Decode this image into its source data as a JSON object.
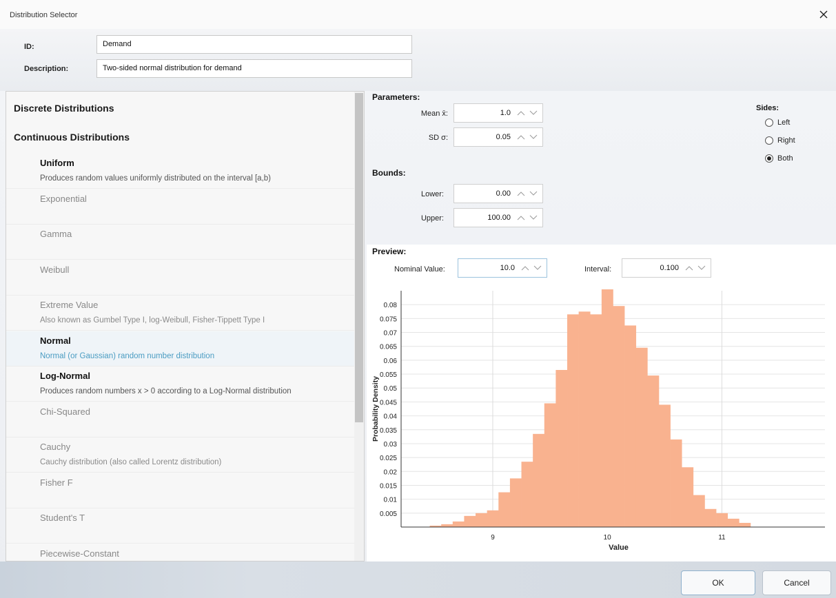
{
  "window": {
    "title": "Distribution Selector"
  },
  "form": {
    "id_label": "ID:",
    "id_value": "Demand",
    "desc_label": "Description:",
    "desc_value": "Two-sided normal distribution for demand"
  },
  "categories": {
    "discrete": "Discrete Distributions",
    "continuous": "Continuous Distributions"
  },
  "distributions": [
    {
      "name": "Uniform",
      "desc": "Produces random values uniformly distributed on the interval [a,b)",
      "style": "bold"
    },
    {
      "name": "Exponential",
      "desc": "",
      "style": "normal"
    },
    {
      "name": "Gamma",
      "desc": "",
      "style": "normal"
    },
    {
      "name": "Weibull",
      "desc": "",
      "style": "normal"
    },
    {
      "name": "Extreme Value",
      "desc": "Also known as Gumbel Type I, log-Weibull, Fisher-Tippett Type I",
      "style": "normal"
    },
    {
      "name": "Normal",
      "desc": "Normal (or Gaussian) random number distribution",
      "style": "selected"
    },
    {
      "name": "Log-Normal",
      "desc": "Produces random numbers x > 0 according to a Log-Normal distribution",
      "style": "bold"
    },
    {
      "name": "Chi-Squared",
      "desc": "",
      "style": "normal"
    },
    {
      "name": "Cauchy",
      "desc": "Cauchy distribution (also called Lorentz distribution)",
      "style": "normal"
    },
    {
      "name": "Fisher F",
      "desc": "",
      "style": "normal"
    },
    {
      "name": "Student's T",
      "desc": "",
      "style": "normal"
    },
    {
      "name": "Piecewise-Constant",
      "desc": "",
      "style": "normal"
    }
  ],
  "parameters": {
    "label": "Parameters:",
    "mean_label": "Mean x̄:",
    "mean_value": "1.0",
    "sd_label": "SD σ:",
    "sd_value": "0.05"
  },
  "bounds": {
    "label": "Bounds:",
    "lower_label": "Lower:",
    "lower_value": "0.00",
    "upper_label": "Upper:",
    "upper_value": "100.00"
  },
  "sides": {
    "label": "Sides:",
    "options": [
      "Left",
      "Right",
      "Both"
    ],
    "selected": "Both"
  },
  "preview": {
    "label": "Preview:",
    "nominal_label": "Nominal Value:",
    "nominal_value": "10.0",
    "interval_label": "Interval:",
    "interval_value": "0.100"
  },
  "chart_data": {
    "type": "bar",
    "bar_color": "#f9b28f",
    "xlabel": "Value",
    "ylabel": "Probability Density",
    "xlim": [
      8.2,
      11.9
    ],
    "ylim": [
      0,
      0.085
    ],
    "xticks": [
      9,
      10,
      11
    ],
    "yticks": [
      0.005,
      0.01,
      0.015,
      0.02,
      0.025,
      0.03,
      0.035,
      0.04,
      0.045,
      0.05,
      0.055,
      0.06,
      0.065,
      0.07,
      0.075,
      0.08
    ],
    "grid": true,
    "bin_width": 0.1,
    "bins_start": 8.45,
    "values": [
      0.0005,
      0.001,
      0.002,
      0.004,
      0.005,
      0.006,
      0.0125,
      0.0175,
      0.0235,
      0.0335,
      0.0445,
      0.0565,
      0.0765,
      0.0775,
      0.0765,
      0.0855,
      0.0795,
      0.0725,
      0.0645,
      0.0545,
      0.044,
      0.0315,
      0.0215,
      0.0115,
      0.0065,
      0.005,
      0.003,
      0.0015
    ]
  },
  "buttons": {
    "ok": "OK",
    "cancel": "Cancel"
  }
}
